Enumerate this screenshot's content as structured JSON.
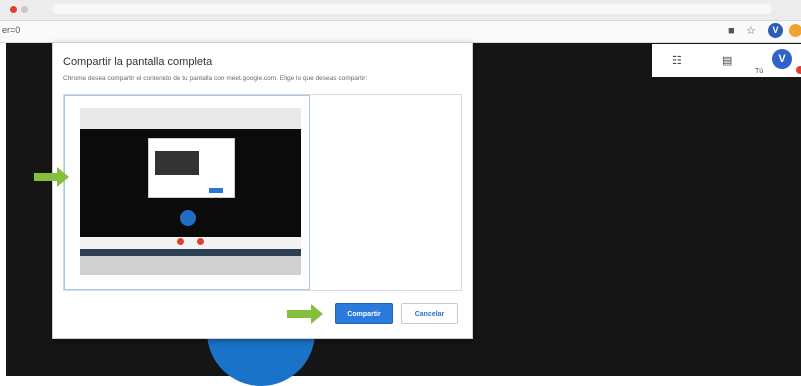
{
  "browser": {
    "url_fragment": "er=0",
    "icons": [
      "camera-icon",
      "star-icon"
    ],
    "profile_initial": "V"
  },
  "meet": {
    "panel_icons": [
      "people-icon",
      "chat-icon"
    ],
    "self_label": "Tú",
    "avatar_initial": "V"
  },
  "dialog": {
    "title": "Compartir la pantalla completa",
    "description": "Chrome desea compartir el contenido de tu pantalla con meet.google.com. Elige lo que deseas compartir:",
    "share_label": "Compartir",
    "cancel_label": "Cancelar"
  },
  "colors": {
    "accent": "#2a7bdc",
    "arrow": "#85bf3b",
    "meet_background": "#151515",
    "meet_circle": "#1a73c9"
  }
}
